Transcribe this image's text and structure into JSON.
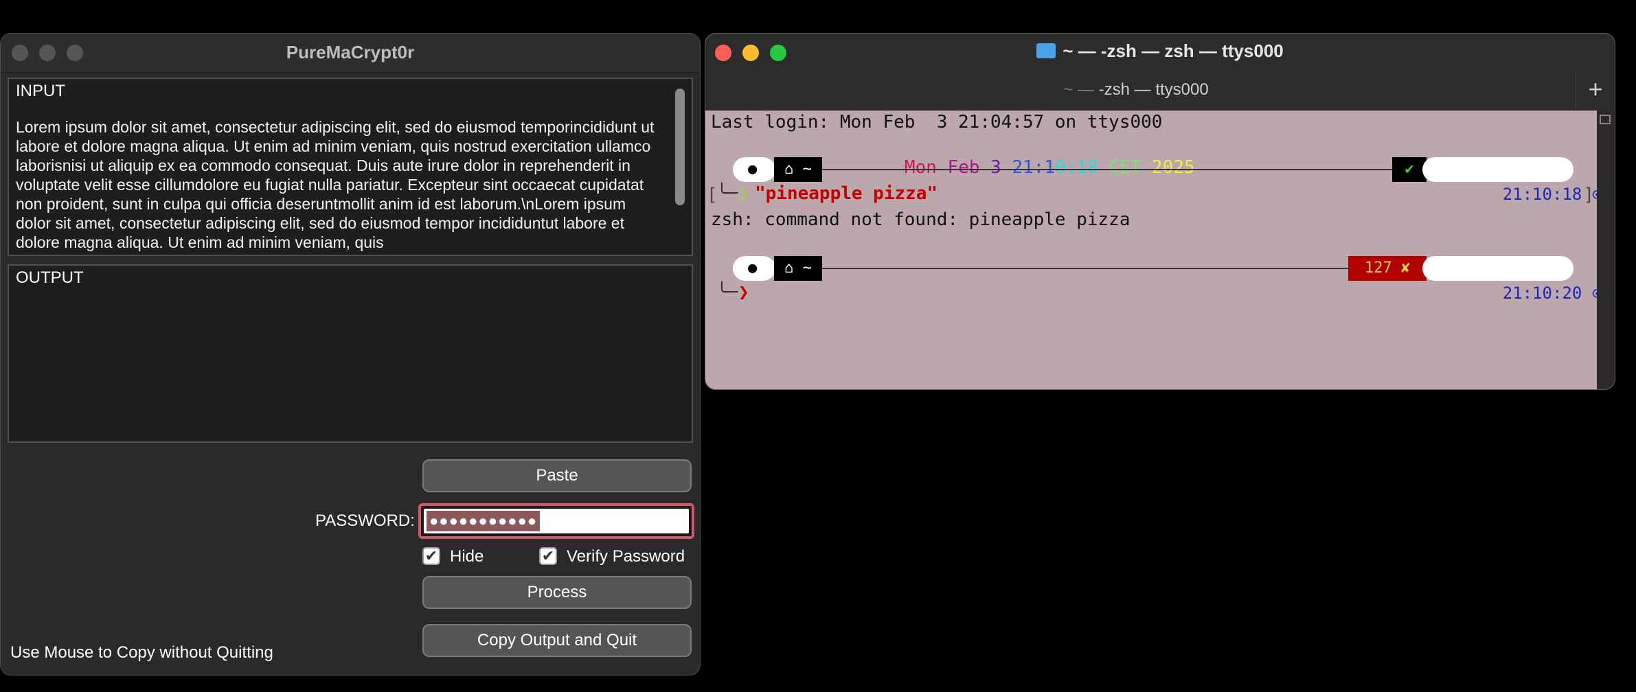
{
  "left_window": {
    "title": "PureMaCrypt0r",
    "input": {
      "label": "INPUT",
      "text": "Lorem ipsum dolor sit amet, consectetur adipiscing elit, sed do eiusmod temporincididunt ut labore et dolore magna aliqua. Ut enim ad minim veniam, quis nostrud exercitation ullamco laborisnisi ut aliquip ex ea commodo consequat. Duis aute irure dolor in reprehenderit in voluptate velit esse cillumdolore eu fugiat nulla pariatur. Excepteur sint occaecat cupidatat non proident, sunt in culpa qui officia deseruntmollit anim id est laborum.\\nLorem ipsum dolor sit amet, consectetur adipiscing elit, sed do eiusmod tempor incididuntut labore et dolore magna aliqua. Ut enim ad minim veniam, quis"
    },
    "output": {
      "label": "OUTPUT",
      "text": ""
    },
    "paste_label": "Paste",
    "password_label": "PASSWORD:",
    "password_mask": "●●●●●●●●●●●",
    "hide_label": "Hide",
    "hide_checked": true,
    "verify_label": "Verify Password",
    "verify_checked": true,
    "process_label": "Process",
    "copy_quit_label": "Copy Output and Quit",
    "footer_note": "Use Mouse to Copy without Quitting"
  },
  "terminal": {
    "title": "~ — -zsh — zsh — ttys000",
    "tab_dim": "~ —",
    "tab_label": "-zsh — ttys000",
    "plus_label": "+",
    "last_login": "Last login: Mon Feb  3 21:04:57 on ttys000",
    "date_parts": [
      "Mon",
      "Feb",
      "3",
      "21:1",
      "0:18",
      "CET",
      "2025"
    ],
    "prompt1": {
      "home": "~",
      "status": "✔",
      "time": "21:10:18",
      "command": "\"pineapple pizza\""
    },
    "error_line": "zsh: command not found: pineapple pizza",
    "prompt2": {
      "home": "~",
      "status_code": "127",
      "status_icon": "✘",
      "time": "21:10:20"
    },
    "prompt_chevron": "❯",
    "colors": {
      "background": "#bca8ac",
      "error_bg": "#b00000",
      "time_color": "#1a27b8"
    }
  }
}
